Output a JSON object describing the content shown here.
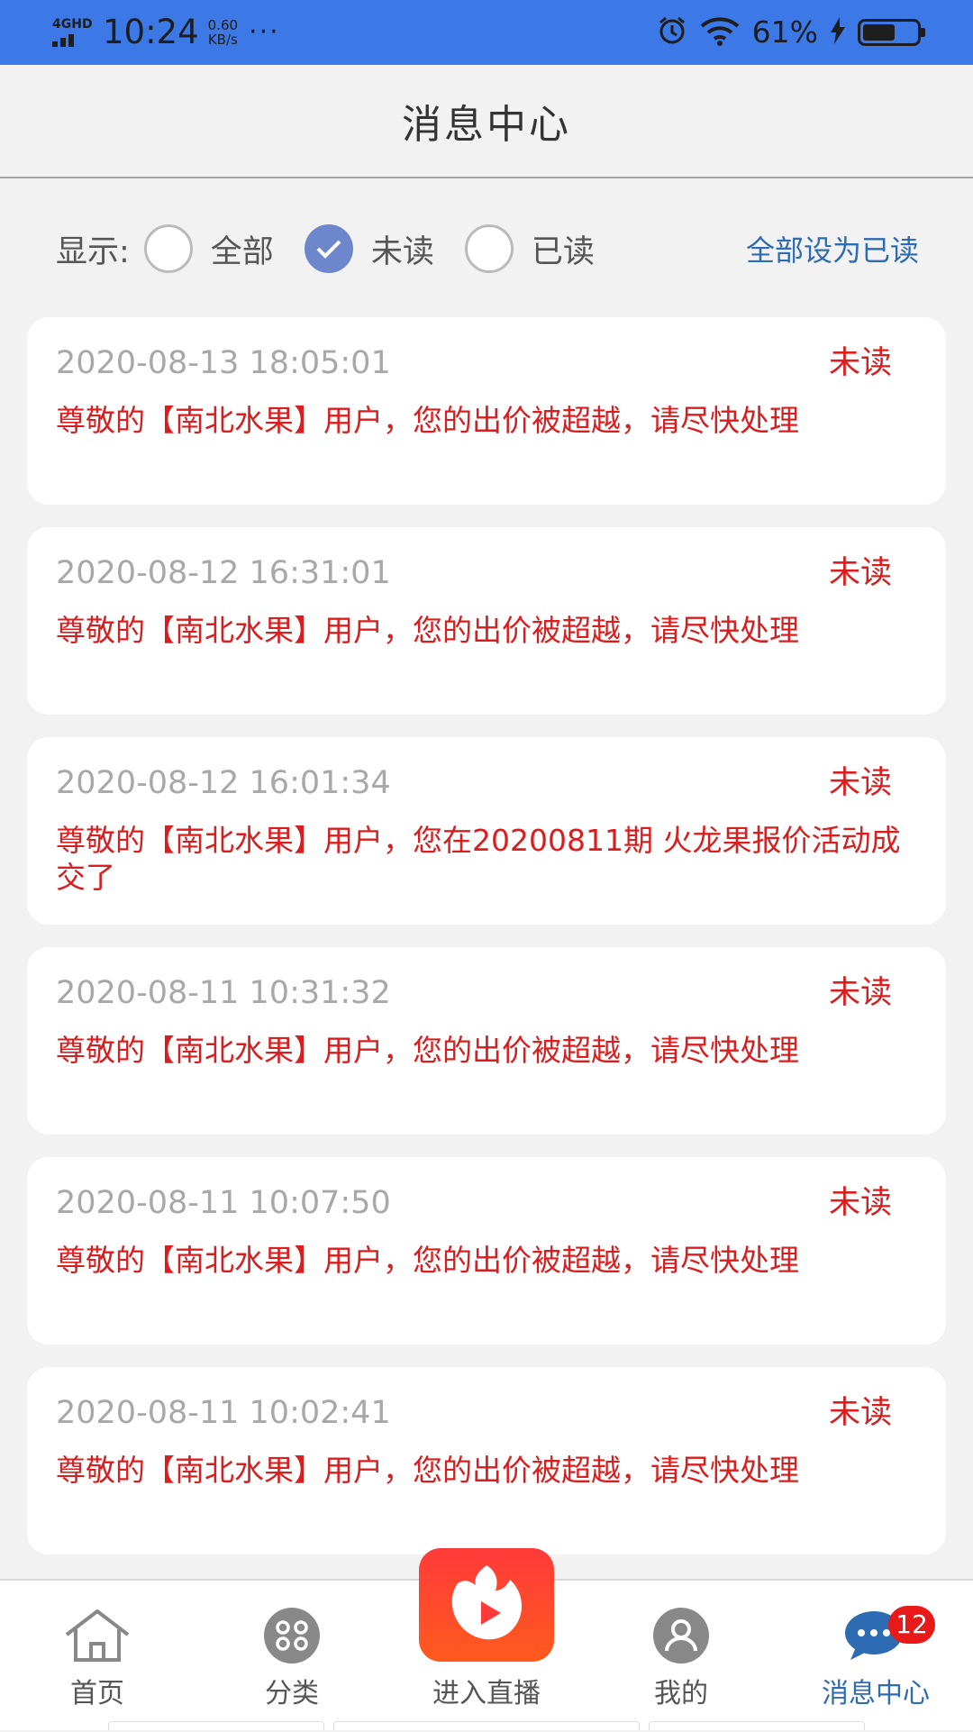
{
  "status_bar": {
    "network": "4GHD",
    "time": "10:24",
    "speed_value": "0.60",
    "speed_unit": "KB/s",
    "more": "···",
    "battery_text": "61%",
    "battery_level": 0.61,
    "icons": [
      "alarm-icon",
      "wifi-icon",
      "charging-icon",
      "battery-icon"
    ]
  },
  "header": {
    "title": "消息中心"
  },
  "filter": {
    "label": "显示:",
    "options": [
      {
        "label": "全部",
        "checked": false
      },
      {
        "label": "未读",
        "checked": true
      },
      {
        "label": "已读",
        "checked": false
      }
    ],
    "mark_all_label": "全部设为已读"
  },
  "messages": [
    {
      "time": "2020-08-13 18:05:01",
      "status": "未读",
      "text": "尊敬的【南北水果】用户，您的出价被超越，请尽快处理"
    },
    {
      "time": "2020-08-12 16:31:01",
      "status": "未读",
      "text": "尊敬的【南北水果】用户，您的出价被超越，请尽快处理"
    },
    {
      "time": "2020-08-12 16:01:34",
      "status": "未读",
      "text": "尊敬的【南北水果】用户，您在20200811期 火龙果报价活动成交了"
    },
    {
      "time": "2020-08-11 10:31:32",
      "status": "未读",
      "text": "尊敬的【南北水果】用户，您的出价被超越，请尽快处理"
    },
    {
      "time": "2020-08-11 10:07:50",
      "status": "未读",
      "text": "尊敬的【南北水果】用户，您的出价被超越，请尽快处理"
    },
    {
      "time": "2020-08-11 10:02:41",
      "status": "未读",
      "text": "尊敬的【南北水果】用户，您的出价被超越，请尽快处理"
    }
  ],
  "nav": {
    "items": [
      {
        "label": "首页",
        "icon": "home-icon"
      },
      {
        "label": "分类",
        "icon": "category-icon"
      },
      {
        "label": "进入直播",
        "icon": "live-play-icon"
      },
      {
        "label": "我的",
        "icon": "user-icon"
      },
      {
        "label": "消息中心",
        "icon": "message-icon",
        "badge": "12",
        "active": true
      }
    ]
  },
  "colors": {
    "status_bar": "#3c78e6",
    "unread_red": "#d81e1e",
    "link_blue": "#2d6bb3",
    "radio_checked": "#6e87cc",
    "live_button": "#ff3a3a"
  }
}
